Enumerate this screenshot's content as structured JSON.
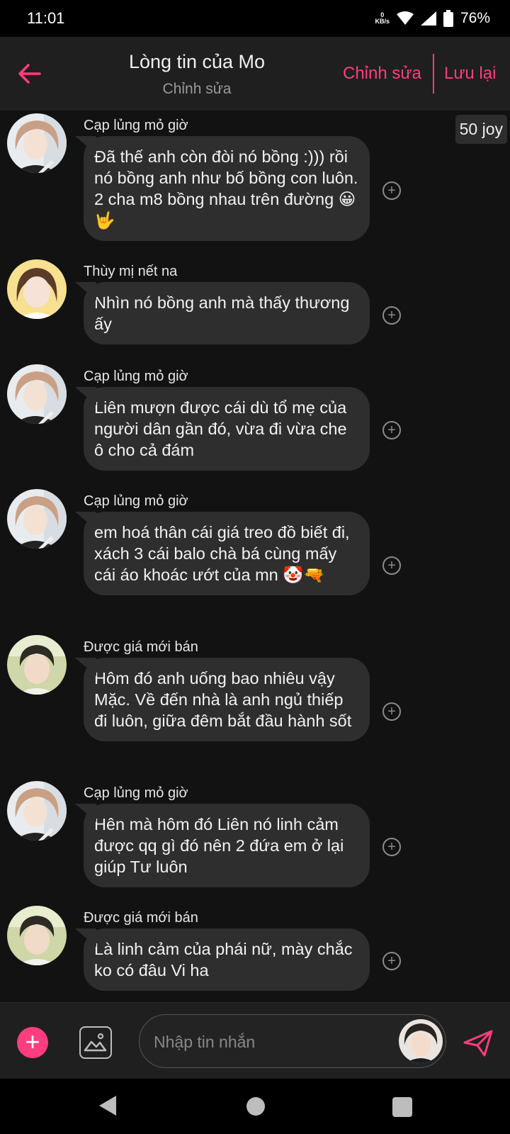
{
  "status_bar": {
    "time": "11:01",
    "net_speed_value": "0",
    "net_speed_unit": "KB/s",
    "battery": "76%"
  },
  "header": {
    "title": "Lòng tin của Mo",
    "subtitle": "Chỉnh sửa",
    "edit_label": "Chỉnh sửa",
    "save_label": "Lưu lại",
    "accent_color": "#ff3d7f"
  },
  "joy_badge": "50 joy",
  "messages": [
    {
      "sender": "Cạp lủng mỏ giờ",
      "text": "Đã thế anh còn đòi nó bồng :))) rồi nó bồng anh như bố bồng con luôn. 2 cha m8 bồng nhau trên đường 😀🤟",
      "avatar": "avatar-a"
    },
    {
      "sender": "Thùy mị nết na",
      "text": "Nhìn nó bồng anh mà thấy thương ấy",
      "avatar": "avatar-b"
    },
    {
      "sender": "Cạp lủng mỏ giờ",
      "text": "Liên mượn được cái dù tổ mẹ của người dân gần đó, vừa đi vừa che ô cho cả đám",
      "avatar": "avatar-a"
    },
    {
      "sender": "Cạp lủng mỏ giờ",
      "text": "em hoá thân cái giá treo đồ biết đi, xách 3 cái balo chà bá cùng mấy cái áo khoác ướt của mn 🤡🔫",
      "avatar": "avatar-a"
    },
    {
      "sender": "Được giá mới bán",
      "text": "Hôm đó anh uống bao nhiêu vậy Mặc. Về đến nhà là anh ngủ thiếp đi luôn, giữa đêm bắt đầu hành sốt",
      "avatar": "avatar-c"
    },
    {
      "sender": "Cạp lủng mỏ giờ",
      "text": "Hên mà hôm đó Liên nó linh cảm được qq gì đó nên 2 đứa em ở lại giúp Tư luôn",
      "avatar": "avatar-a"
    },
    {
      "sender": "Được giá mới bán",
      "text": "Là linh cảm của phái nữ, mày chắc ko có đâu Vi ha",
      "avatar": "avatar-c"
    }
  ],
  "react_icon": "plus-circle-icon",
  "composer": {
    "placeholder": "Nhập tin nhắn",
    "add_icon": "plus-icon",
    "image_icon": "image-icon",
    "send_icon": "send-icon"
  }
}
